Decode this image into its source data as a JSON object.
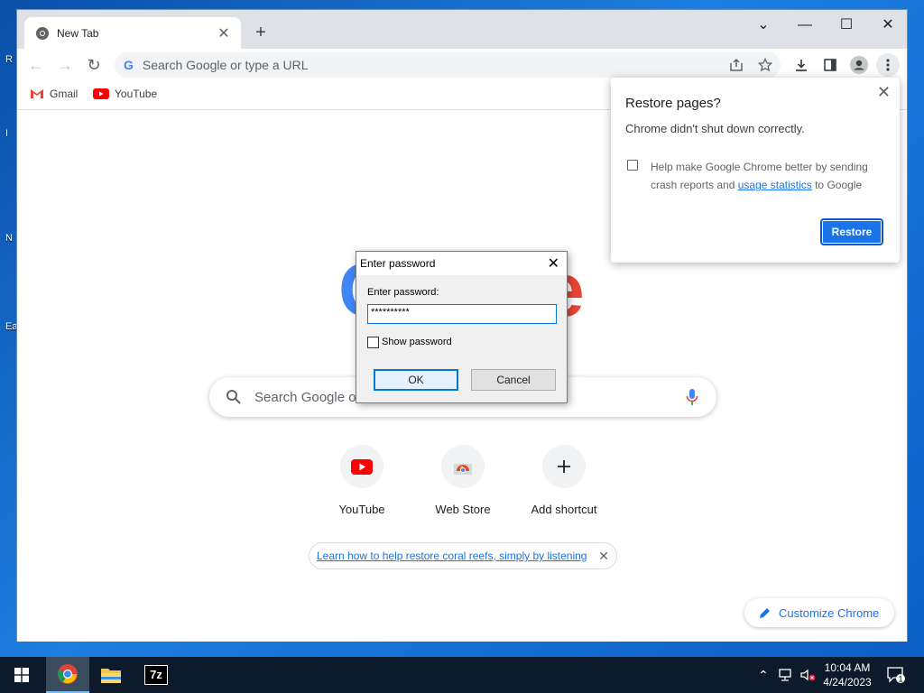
{
  "desktop": {
    "labels": [
      "R",
      "I",
      "N",
      "Ea"
    ]
  },
  "browser": {
    "tab": {
      "title": "New Tab",
      "favicon": "chrome-icon",
      "close": "✕"
    },
    "new_tab_symbol": "+",
    "window_controls": {
      "tab_search": "⌄",
      "minimize": "—",
      "maximize": "☐",
      "close": "✕"
    },
    "omnibox": {
      "placeholder": "Search Google or type a URL",
      "google_glyph": "G"
    },
    "bookmarks": [
      {
        "label": "Gmail",
        "icon": "gmail-icon"
      },
      {
        "label": "YouTube",
        "icon": "youtube-icon"
      }
    ]
  },
  "ntp": {
    "logo_visible": [
      "G",
      "e"
    ],
    "search_placeholder": "Search Google or type a URL",
    "search_placeholder_visible": "Search Google o",
    "shortcuts": [
      {
        "label": "YouTube",
        "icon": "youtube-icon"
      },
      {
        "label": "Web Store",
        "icon": "webstore-icon"
      },
      {
        "label": "Add shortcut",
        "icon": "plus-icon"
      }
    ],
    "promo": {
      "text": "Learn how to help restore coral reefs, simply by listening",
      "close": "✕"
    },
    "customize": {
      "label": "Customize Chrome"
    }
  },
  "restore_bubble": {
    "title": "Restore pages?",
    "message": "Chrome didn't shut down correctly.",
    "checkbox_text_before": "Help make Google Chrome better by sending crash reports and ",
    "checkbox_link": "usage statistics",
    "checkbox_text_after": " to Google",
    "checkbox_checked": false,
    "button": "Restore",
    "close": "✕"
  },
  "password_dialog": {
    "title": "Enter password",
    "label": "Enter password:",
    "value": "**********",
    "show_password_label": "Show password",
    "show_password_checked": false,
    "ok": "OK",
    "cancel": "Cancel",
    "close": "✕"
  },
  "taskbar": {
    "apps": [
      "chrome-icon",
      "file-explorer-icon",
      "7zip-icon"
    ],
    "seven_zip_label": "7z",
    "time": "10:04 AM",
    "date": "4/24/2023",
    "notification_count": "1"
  },
  "colors": {
    "accent": "#1a73e8",
    "google_blue": "#4285f4",
    "google_red": "#ea4335",
    "youtube_red": "#ff0000",
    "taskbar": "#0c1a2c"
  }
}
